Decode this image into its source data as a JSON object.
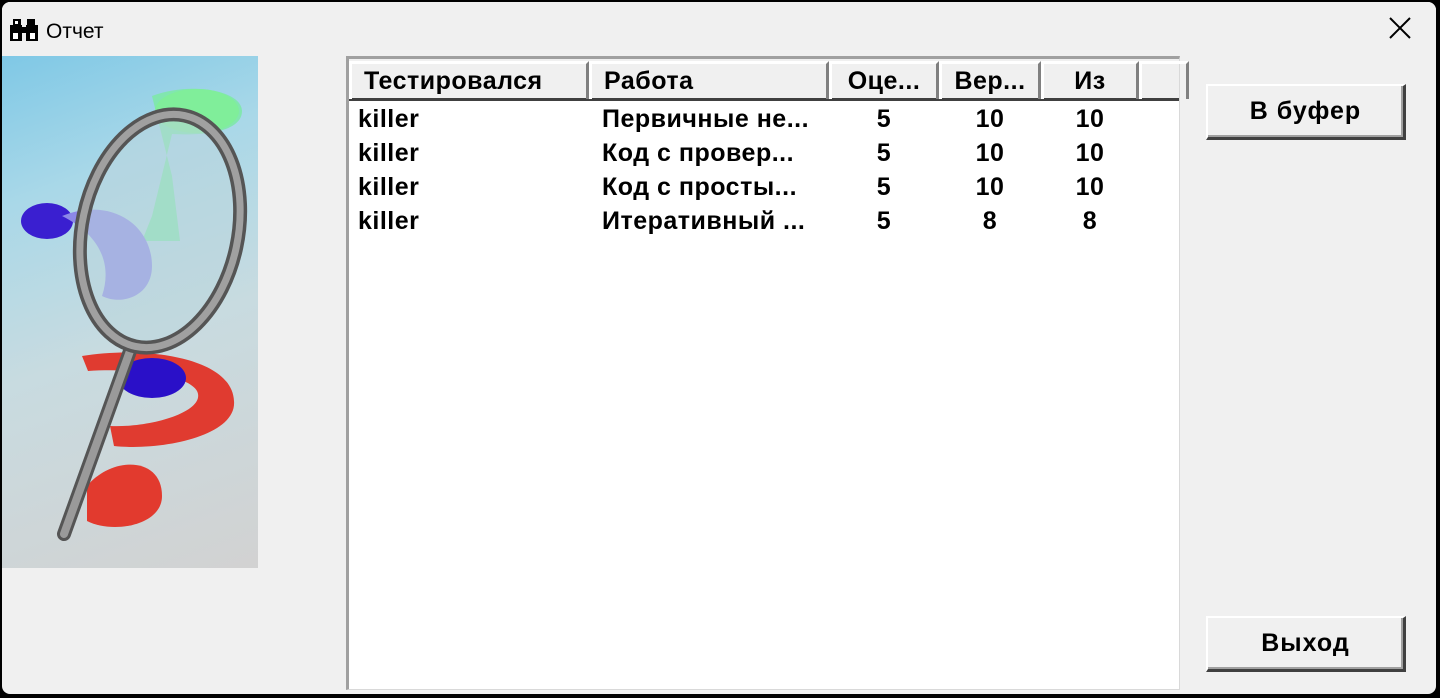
{
  "window": {
    "title": "Отчет"
  },
  "icons": {
    "app": "binoculars-icon",
    "close": "close-icon"
  },
  "table": {
    "columns": [
      "Тестировался",
      "Работа",
      "Оце...",
      "Вер...",
      "Из"
    ],
    "rows": [
      [
        "killer",
        "Первичные не...",
        "5",
        "10",
        "10"
      ],
      [
        "killer",
        "Код с провер...",
        "5",
        "10",
        "10"
      ],
      [
        "killer",
        "Код с просты...",
        "5",
        "10",
        "10"
      ],
      [
        "killer",
        "Итеративный ...",
        "5",
        "8",
        "8"
      ]
    ]
  },
  "buttons": {
    "copy": "В буфер",
    "exit": "Выход"
  },
  "colors": {
    "window_bg": "#f0f0f0",
    "list_bg": "#ffffff"
  }
}
